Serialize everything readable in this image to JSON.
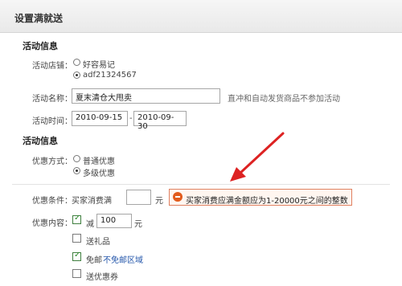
{
  "header": {
    "title": "设置满就送"
  },
  "activity_info": {
    "section_title": "活动信息",
    "store_label": "活动店铺：",
    "store_options": [
      {
        "label": "好容易记",
        "selected": false
      },
      {
        "label": "adf21324567",
        "selected": true
      }
    ],
    "name_label": "活动名称：",
    "name_value": "夏末清仓大甩卖",
    "name_hint": "直冲和自动发货商品不参加活动",
    "time_label": "活动时间：",
    "start_date": "2010-09-15",
    "date_sep": "-",
    "end_date": "2010-09-30"
  },
  "discount_info": {
    "section_title": "活动信息",
    "mode_label": "优惠方式：",
    "mode_options": [
      {
        "label": "普通优惠",
        "selected": false
      },
      {
        "label": "多级优惠",
        "selected": true
      }
    ]
  },
  "condition": {
    "label": "优惠条件：",
    "prefix": "买家消费满",
    "amount_value": "",
    "unit": "元",
    "error_text": "买家消费应满金额应为1-20000元之间的整数",
    "accent_color": "#e25b1c"
  },
  "content": {
    "label": "优惠内容：",
    "reduce": {
      "checked": true,
      "label": "减",
      "value": "100",
      "unit": "元"
    },
    "gift": {
      "checked": false,
      "label": "送礼品"
    },
    "free_shipping": {
      "checked": true,
      "label": "免邮",
      "link": "不免邮区域"
    },
    "coupon": {
      "checked": false,
      "label": "送优惠券"
    }
  },
  "annotation": {
    "arrow_color": "#dd2222"
  }
}
